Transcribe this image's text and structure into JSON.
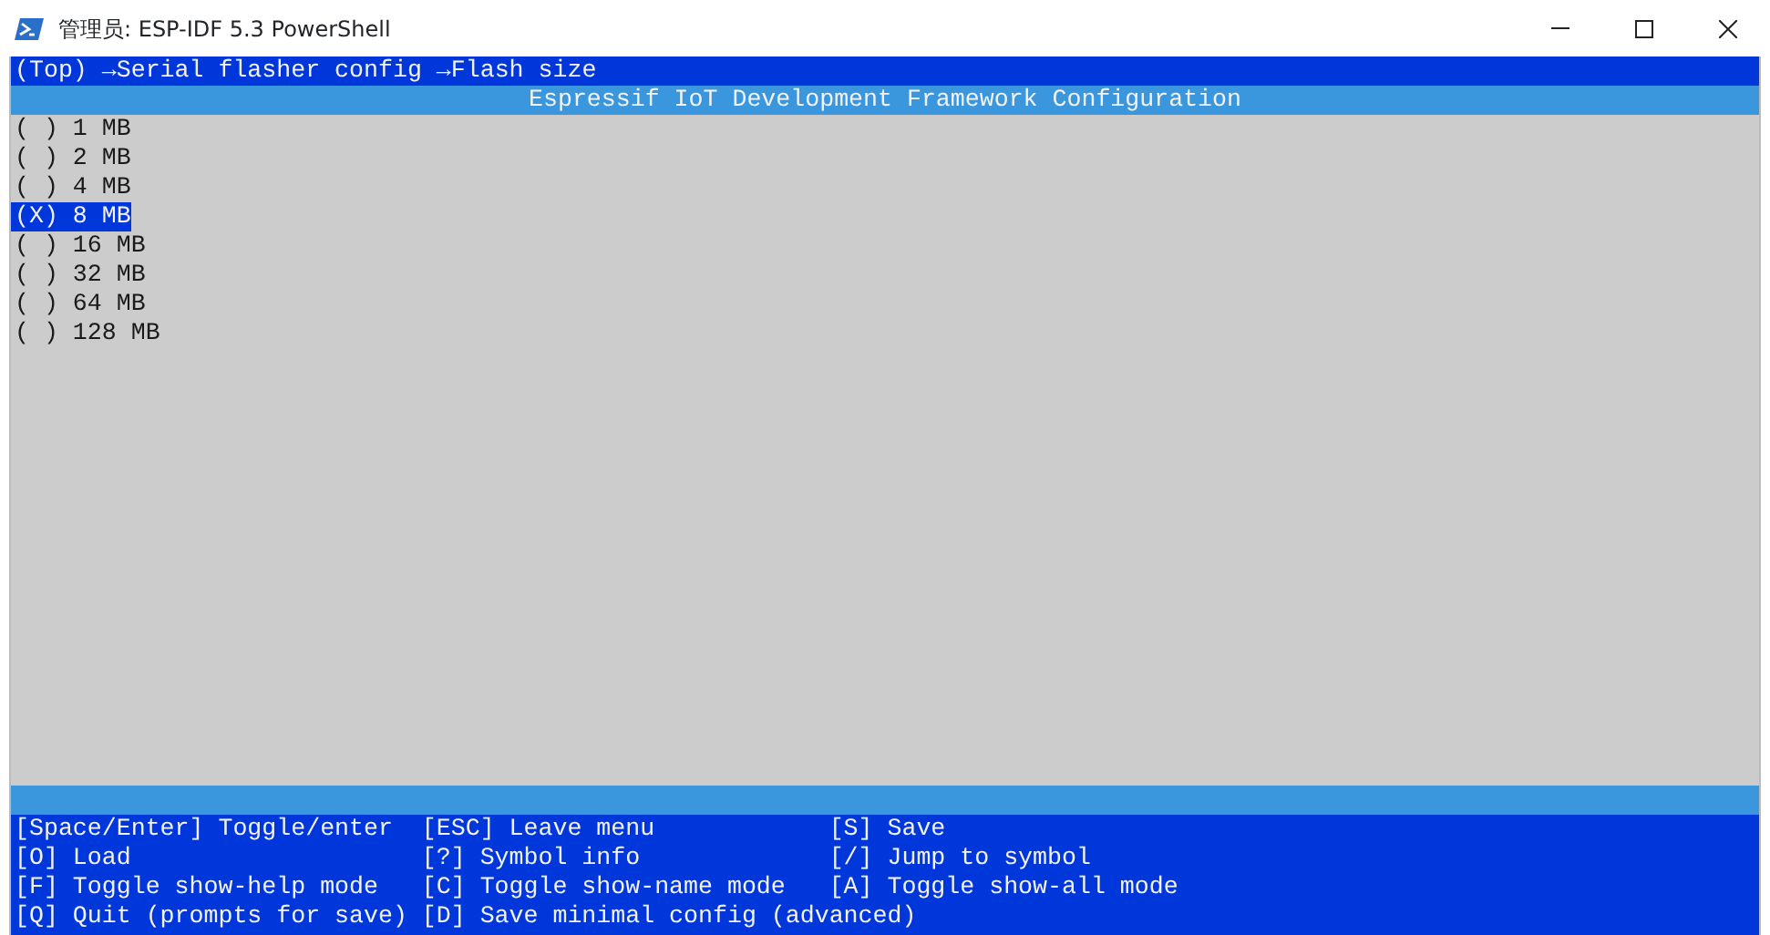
{
  "window": {
    "title": "管理员: ESP-IDF 5.3 PowerShell"
  },
  "breadcrumb": "(Top) →Serial flasher config →Flash size",
  "header": "Espressif IoT Development Framework Configuration",
  "options": [
    {
      "label": "( ) 1 MB",
      "selected": false
    },
    {
      "label": "( ) 2 MB",
      "selected": false
    },
    {
      "label": "( ) 4 MB",
      "selected": false
    },
    {
      "label": "(X) 8 MB",
      "selected": true
    },
    {
      "label": "( ) 16 MB",
      "selected": false
    },
    {
      "label": "( ) 32 MB",
      "selected": false
    },
    {
      "label": "( ) 64 MB",
      "selected": false
    },
    {
      "label": "( ) 128 MB",
      "selected": false
    }
  ],
  "help": [
    [
      "[Space/Enter] Toggle/enter",
      "[ESC] Leave menu",
      "[S] Save"
    ],
    [
      "[O] Load",
      "[?] Symbol info",
      "[/] Jump to symbol"
    ],
    [
      "[F] Toggle show-help mode",
      "[C] Toggle show-name mode",
      "[A] Toggle show-all mode"
    ],
    [
      "[Q] Quit (prompts for save)",
      "[D] Save minimal config (advanced)"
    ]
  ]
}
